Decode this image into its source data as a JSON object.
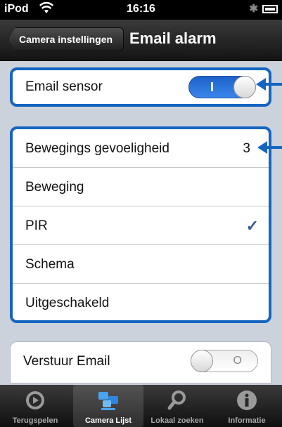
{
  "status_bar": {
    "carrier": "iPod",
    "time": "16:16"
  },
  "nav": {
    "back_label": "Camera instellingen",
    "title": "Email alarm"
  },
  "email_sensor": {
    "label": "Email sensor",
    "on": true
  },
  "settings": {
    "sensitivity_label": "Bewegings gevoeligheid",
    "sensitivity_value": "3",
    "options": [
      {
        "label": "Beweging",
        "checked": false
      },
      {
        "label": "PIR",
        "checked": true
      },
      {
        "label": "Schema",
        "checked": false
      },
      {
        "label": "Uitgeschakeld",
        "checked": false
      }
    ],
    "check_glyph": "✓"
  },
  "send_email": {
    "label": "Verstuur Email",
    "on": false
  },
  "tabs": [
    {
      "label": "Terugspelen",
      "icon": "playback-icon"
    },
    {
      "label": "Camera Lijst",
      "icon": "camera-list-icon",
      "active": true
    },
    {
      "label": "Lokaal zoeken",
      "icon": "search-icon"
    },
    {
      "label": "Informatie",
      "icon": "info-icon"
    }
  ],
  "colors": {
    "annotation_blue": "#1565c0",
    "switch_on": "#2f78e0"
  }
}
